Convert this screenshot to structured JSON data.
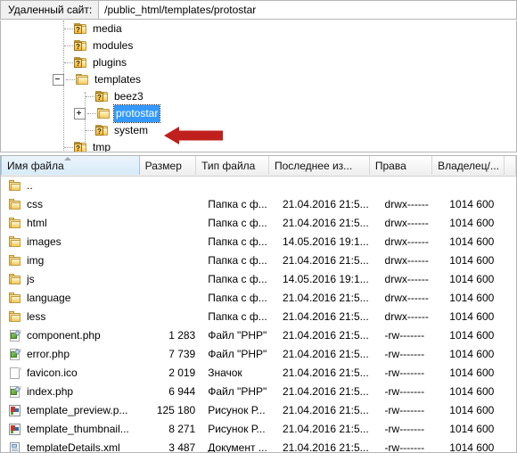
{
  "pathbar": {
    "label": "Удаленный сайт:",
    "value": "/public_html/templates/protostar"
  },
  "tree": {
    "nodes": [
      {
        "label": "media",
        "indent": 0,
        "expander": "none",
        "icon": "folder-question-icon",
        "selected": false
      },
      {
        "label": "modules",
        "indent": 0,
        "expander": "none",
        "icon": "folder-question-icon",
        "selected": false
      },
      {
        "label": "plugins",
        "indent": 0,
        "expander": "none",
        "icon": "folder-question-icon",
        "selected": false
      },
      {
        "label": "templates",
        "indent": 0,
        "expander": "minus",
        "icon": "folder-icon",
        "selected": false
      },
      {
        "label": "beez3",
        "indent": 1,
        "expander": "none",
        "icon": "folder-question-icon",
        "selected": false
      },
      {
        "label": "protostar",
        "indent": 1,
        "expander": "plus",
        "icon": "folder-icon",
        "selected": true
      },
      {
        "label": "system",
        "indent": 1,
        "expander": "none",
        "icon": "folder-question-icon",
        "selected": false
      },
      {
        "label": "tmp",
        "indent": 0,
        "expander": "none",
        "icon": "folder-question-icon",
        "selected": false
      }
    ],
    "annotation_icon": "red-left-arrow-icon",
    "selection_color": "#3399ff",
    "annotation_color": "#c0201c"
  },
  "filelist": {
    "columns": [
      {
        "key": "name",
        "label": "Имя файла",
        "sorted": true,
        "sort_dir": "asc"
      },
      {
        "key": "size",
        "label": "Размер",
        "sorted": false
      },
      {
        "key": "type",
        "label": "Тип файла",
        "sorted": false
      },
      {
        "key": "date",
        "label": "Последнее из...",
        "sorted": false
      },
      {
        "key": "perm",
        "label": "Права",
        "sorted": false
      },
      {
        "key": "owner",
        "label": "Владелец/...",
        "sorted": false
      }
    ],
    "rows": [
      {
        "icon": "folder-icon",
        "name": "..",
        "size": "",
        "type": "",
        "date": "",
        "perm": "",
        "owner": ""
      },
      {
        "icon": "folder-icon",
        "name": "css",
        "size": "",
        "type": "Папка с ф...",
        "date": "21.04.2016 21:5...",
        "perm": "drwx------",
        "owner": "1014 600"
      },
      {
        "icon": "folder-icon",
        "name": "html",
        "size": "",
        "type": "Папка с ф...",
        "date": "21.04.2016 21:5...",
        "perm": "drwx------",
        "owner": "1014 600"
      },
      {
        "icon": "folder-icon",
        "name": "images",
        "size": "",
        "type": "Папка с ф...",
        "date": "14.05.2016 19:1...",
        "perm": "drwx------",
        "owner": "1014 600"
      },
      {
        "icon": "folder-icon",
        "name": "img",
        "size": "",
        "type": "Папка с ф...",
        "date": "21.04.2016 21:5...",
        "perm": "drwx------",
        "owner": "1014 600"
      },
      {
        "icon": "folder-icon",
        "name": "js",
        "size": "",
        "type": "Папка с ф...",
        "date": "14.05.2016 19:1...",
        "perm": "drwx------",
        "owner": "1014 600"
      },
      {
        "icon": "folder-icon",
        "name": "language",
        "size": "",
        "type": "Папка с ф...",
        "date": "21.04.2016 21:5...",
        "perm": "drwx------",
        "owner": "1014 600"
      },
      {
        "icon": "folder-icon",
        "name": "less",
        "size": "",
        "type": "Папка с ф...",
        "date": "21.04.2016 21:5...",
        "perm": "drwx------",
        "owner": "1014 600"
      },
      {
        "icon": "php-file-icon",
        "name": "component.php",
        "size": "1 283",
        "type": "Файл \"PHP\"",
        "date": "21.04.2016 21:5...",
        "perm": "-rw-------",
        "owner": "1014 600"
      },
      {
        "icon": "php-file-icon",
        "name": "error.php",
        "size": "7 739",
        "type": "Файл \"PHP\"",
        "date": "21.04.2016 21:5...",
        "perm": "-rw-------",
        "owner": "1014 600"
      },
      {
        "icon": "blank-file-icon",
        "name": "favicon.ico",
        "size": "2 019",
        "type": "Значок",
        "date": "21.04.2016 21:5...",
        "perm": "-rw-------",
        "owner": "1014 600"
      },
      {
        "icon": "php-file-icon",
        "name": "index.php",
        "size": "6 944",
        "type": "Файл \"PHP\"",
        "date": "21.04.2016 21:5...",
        "perm": "-rw-------",
        "owner": "1014 600"
      },
      {
        "icon": "png-file-icon",
        "name": "template_preview.p...",
        "size": "125 180",
        "type": "Рисунок Р...",
        "date": "21.04.2016 21:5...",
        "perm": "-rw-------",
        "owner": "1014 600"
      },
      {
        "icon": "png-file-icon",
        "name": "template_thumbnail...",
        "size": "8 271",
        "type": "Рисунок Р...",
        "date": "21.04.2016 21:5...",
        "perm": "-rw-------",
        "owner": "1014 600"
      },
      {
        "icon": "xml-file-icon",
        "name": "templateDetails.xml",
        "size": "3 487",
        "type": "Документ ...",
        "date": "21.04.2016 21:5...",
        "perm": "-rw-------",
        "owner": "1014 600"
      }
    ]
  }
}
